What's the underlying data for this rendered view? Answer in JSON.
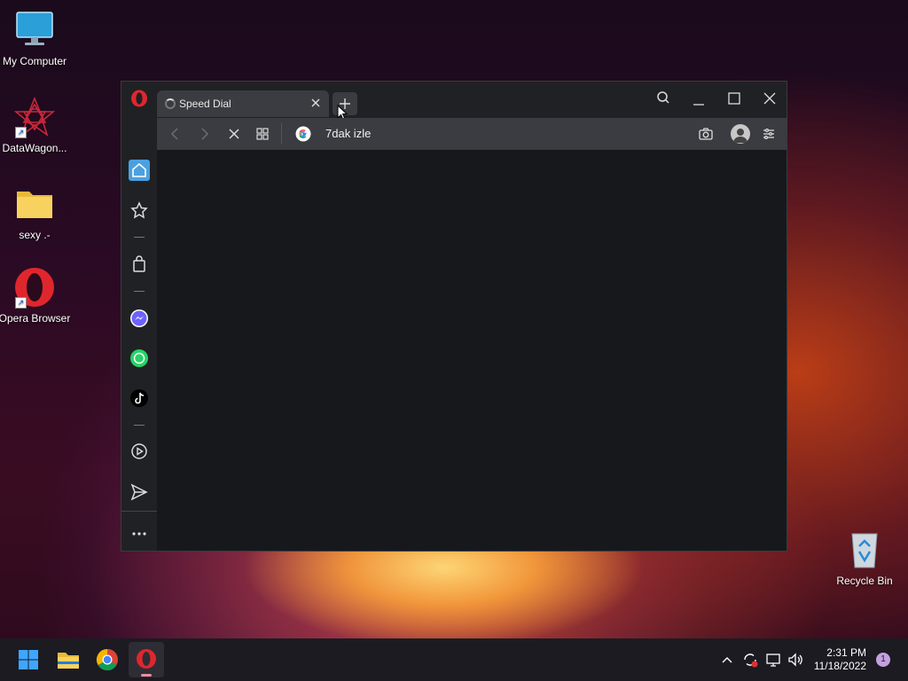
{
  "desktop": {
    "icons": [
      {
        "label": "My Computer"
      },
      {
        "label": "DataWagon..."
      },
      {
        "label": "sexy .-"
      },
      {
        "label": "Opera Browser"
      },
      {
        "label": "Recycle Bin"
      }
    ]
  },
  "browser": {
    "tab": {
      "title": "Speed Dial"
    },
    "address": {
      "url": "7dak izle"
    }
  },
  "taskbar": {
    "time": "2:31 PM",
    "date": "11/18/2022",
    "notification_count": "1"
  },
  "colors": {
    "opera_red": "#e0262d",
    "sidebar_active": "#4aa0e0",
    "messenger": "#6c63ff",
    "whatsapp": "#25d366"
  }
}
